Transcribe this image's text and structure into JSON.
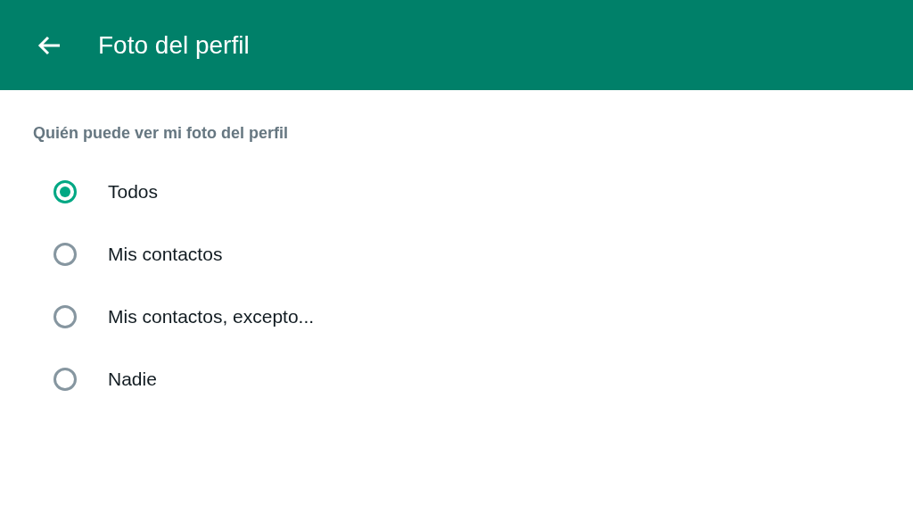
{
  "app_bar": {
    "title": "Foto del perfil"
  },
  "section": {
    "label": "Quién puede ver mi foto del perfil"
  },
  "options": [
    {
      "label": "Todos",
      "selected": true
    },
    {
      "label": "Mis contactos",
      "selected": false
    },
    {
      "label": "Mis contactos, excepto...",
      "selected": false
    },
    {
      "label": "Nadie",
      "selected": false
    }
  ]
}
